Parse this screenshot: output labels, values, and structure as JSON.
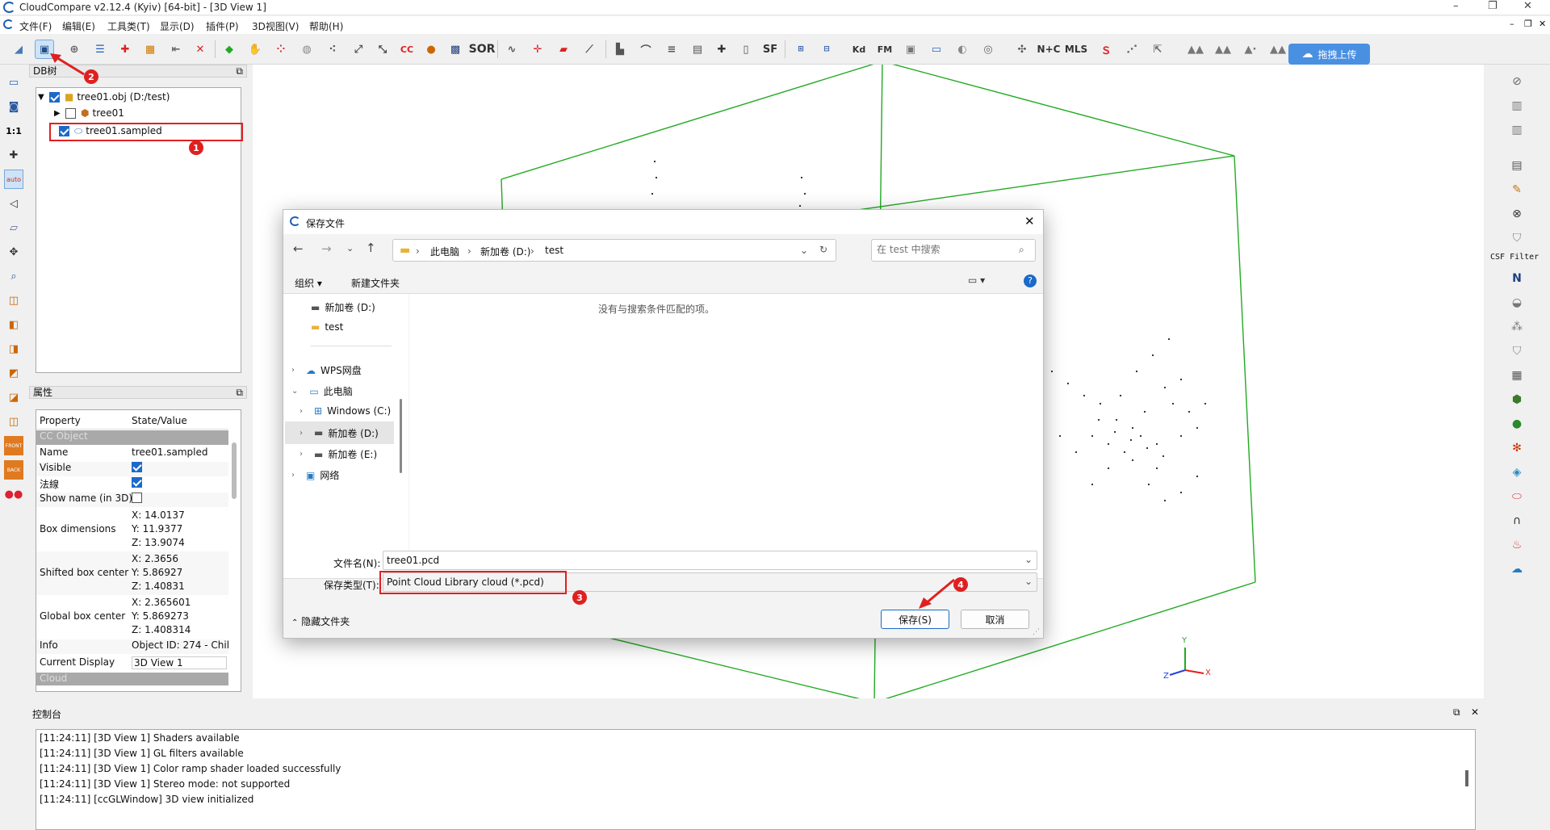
{
  "window": {
    "title": "CloudCompare v2.12.4 (Kyiv) [64-bit] - [3D View 1]"
  },
  "menu": [
    "文件(F)",
    "编辑(E)",
    "工具类(T)",
    "显示(D)",
    "插件(P)",
    "3D视图(V)",
    "帮助(H)"
  ],
  "toolbar": {
    "upload_label": "拖拽上传",
    "sor_label": "SOR",
    "sf_label": "SF",
    "kd_label": "Kd",
    "fm_label": "FM",
    "ntc_label": "N+C",
    "mls_label": "MLS",
    "cc_label": "CC"
  },
  "left_tool": {
    "scale_label": "1:1",
    "auto_label": "auto",
    "front_label": "FRONT",
    "back_label": "BACK"
  },
  "db_panel": {
    "title": "DB树",
    "items": [
      {
        "label": "tree01.obj (D:/test)",
        "checked": true,
        "icon": "folder-icon"
      },
      {
        "label": "tree01",
        "checked": false,
        "icon": "mesh-icon"
      },
      {
        "label": "tree01.sampled",
        "checked": true,
        "icon": "cloud-icon"
      }
    ]
  },
  "props_panel": {
    "title": "属性",
    "header": {
      "property": "Property",
      "value": "State/Value"
    },
    "section": "CC Object",
    "rows": [
      {
        "name": "Name",
        "value": "tree01.sampled"
      },
      {
        "name": "Visible",
        "value": "checked"
      },
      {
        "name": "法線",
        "value": "checked"
      },
      {
        "name": "Show name (in 3D)",
        "value": "unchecked"
      },
      {
        "name": "Box dimensions",
        "values": [
          "X: 14.0137",
          "Y: 11.9377",
          "Z: 13.9074"
        ]
      },
      {
        "name": "Shifted box center",
        "values": [
          "X: 2.3656",
          "Y: 5.86927",
          "Z: 1.40831"
        ]
      },
      {
        "name": "Global box center",
        "values": [
          "X: 2.365601",
          "Y: 5.869273",
          "Z: 1.408314"
        ]
      },
      {
        "name": "Info",
        "value": "Object ID: 274 - Chil"
      },
      {
        "name": "Current Display",
        "value": "3D View 1"
      }
    ],
    "next_section": "Cloud"
  },
  "right_tool": {
    "csf_label": "CSF Filter",
    "n_label": "N"
  },
  "axes": {
    "x": "X",
    "y": "Y",
    "z": "Z"
  },
  "console": {
    "title": "控制台",
    "lines": [
      "[11:24:11] [3D View 1] Shaders available",
      "[11:24:11] [3D View 1] GL filters available",
      "[11:24:11] [3D View 1] Color ramp shader loaded successfully",
      "[11:24:11] [3D View 1] Stereo mode: not supported",
      "[11:24:11] [ccGLWindow] 3D view initialized"
    ]
  },
  "dialog": {
    "title": "保存文件",
    "breadcrumb": [
      "此电脑",
      "新加卷 (D:)",
      "test"
    ],
    "search_placeholder": "在 test 中搜索",
    "organize": "组织",
    "new_folder": "新建文件夹",
    "empty_message": "没有与搜索条件匹配的项。",
    "nav": [
      {
        "label": "新加卷 (D:)",
        "icon": "drive-icon"
      },
      {
        "label": "test",
        "icon": "folder-icon"
      },
      {
        "label": "WPS网盘",
        "icon": "cloud-drive-icon"
      },
      {
        "label": "此电脑",
        "icon": "pc-icon"
      },
      {
        "label": "Windows (C:)",
        "icon": "windows-drive-icon"
      },
      {
        "label": "新加卷 (D:)",
        "icon": "drive-icon"
      },
      {
        "label": "新加卷 (E:)",
        "icon": "drive-icon"
      },
      {
        "label": "网络",
        "icon": "network-icon"
      }
    ],
    "filename_label": "文件名(N):",
    "filename_value": "tree01.pcd",
    "filetype_label": "保存类型(T):",
    "filetype_value": "Point Cloud Library cloud (*.pcd)",
    "hide_folders": "隐藏文件夹",
    "save_button": "保存(S)",
    "cancel_button": "取消"
  },
  "annotations": [
    "1",
    "2",
    "3",
    "4"
  ],
  "colors": {
    "accent": "#1b6ac9",
    "annotation": "#e02020",
    "bbox": "#22aa22",
    "upload": "#4a90e2"
  }
}
